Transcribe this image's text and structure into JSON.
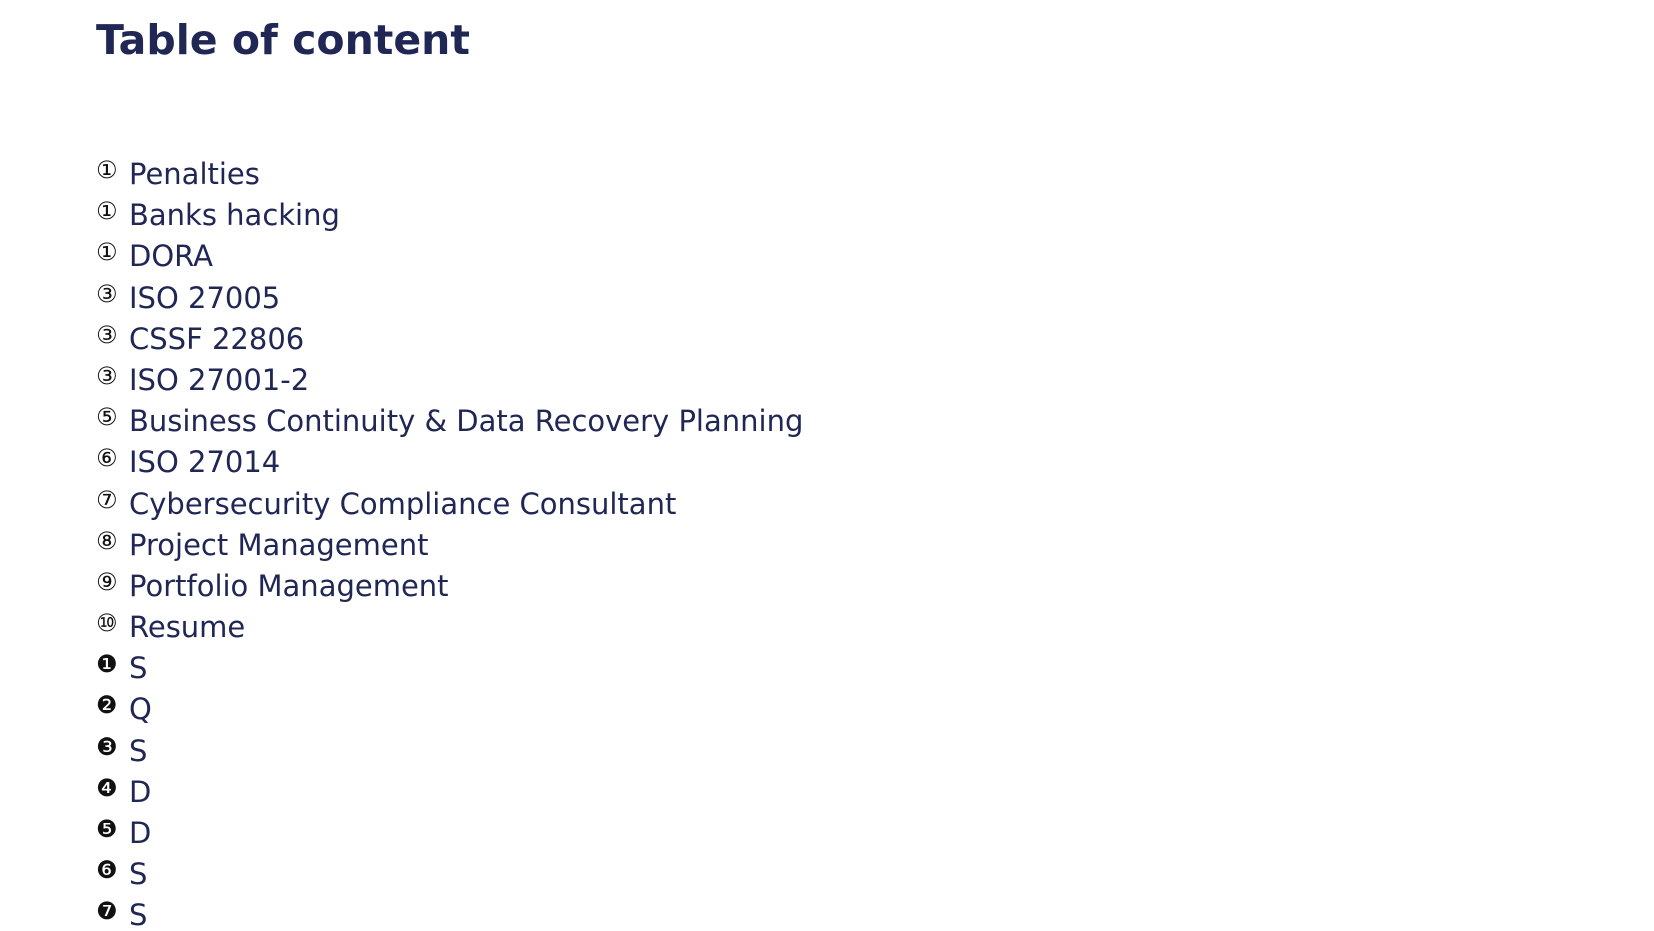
{
  "title": "Table of content",
  "items": [
    {
      "marker": "①",
      "label": "Penalties"
    },
    {
      "marker": "①",
      "label": "Banks hacking"
    },
    {
      "marker": "①",
      "label": "DORA"
    },
    {
      "marker": "③",
      "label": "ISO 27005"
    },
    {
      "marker": "③",
      "label": "CSSF 22806"
    },
    {
      "marker": "③",
      "label": "ISO 27001-2"
    },
    {
      "marker": "⑤",
      "label": "Business Continuity & Data Recovery Planning"
    },
    {
      "marker": "⑥",
      "label": "ISO 27014"
    },
    {
      "marker": "⑦",
      "label": "Cybersecurity Compliance Consultant"
    },
    {
      "marker": "⑧",
      "label": "Project Management"
    },
    {
      "marker": "⑨",
      "label": "Portfolio Management"
    },
    {
      "marker": "⑩",
      "label": "Resume"
    },
    {
      "marker": "❶",
      "label": "S"
    },
    {
      "marker": "❷",
      "label": "Q"
    },
    {
      "marker": "❸",
      "label": "S"
    },
    {
      "marker": "❹",
      "label": "D"
    },
    {
      "marker": "❺",
      "label": "D"
    },
    {
      "marker": "❻",
      "label": "S"
    },
    {
      "marker": "❼",
      "label": "S"
    }
  ],
  "colors": {
    "text": "#202755",
    "marker": "#111111",
    "background": "#ffffff"
  }
}
